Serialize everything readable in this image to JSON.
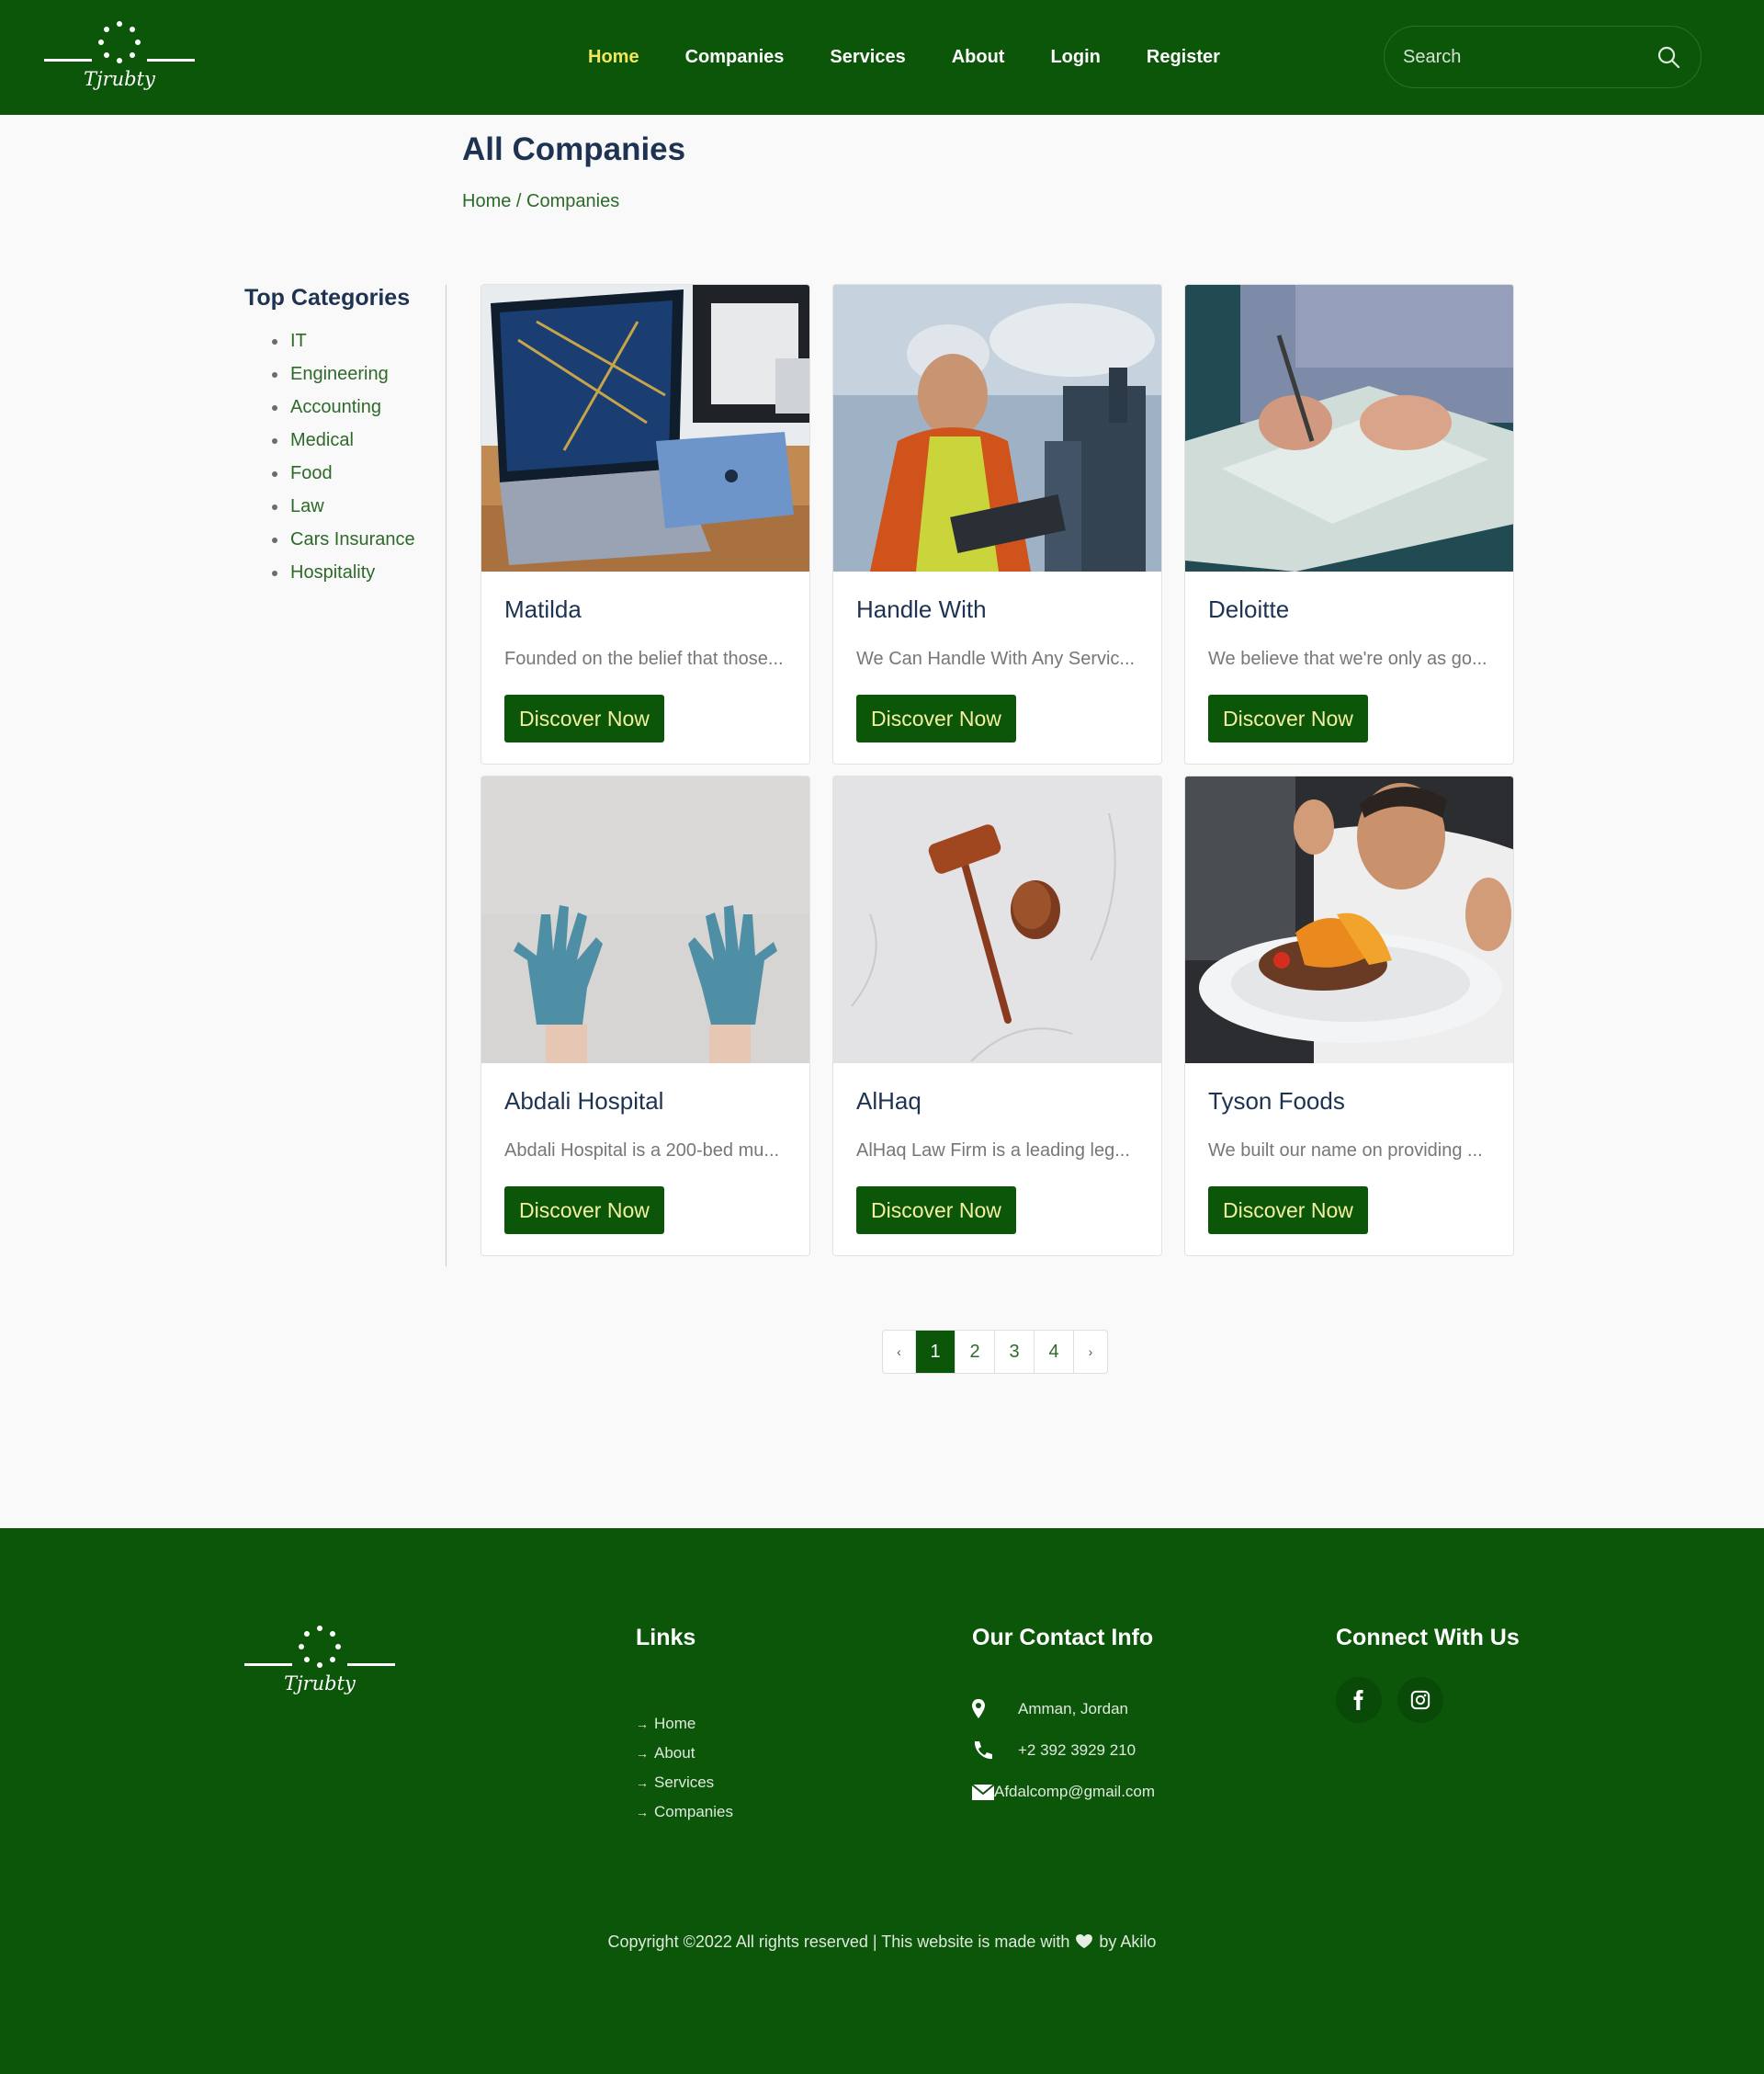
{
  "brand": {
    "name": "Tjrubty"
  },
  "nav": {
    "items": [
      {
        "label": "Home",
        "active": true
      },
      {
        "label": "Companies"
      },
      {
        "label": "Services"
      },
      {
        "label": "About"
      },
      {
        "label": "Login"
      },
      {
        "label": "Register"
      }
    ],
    "search_placeholder": "Search"
  },
  "page": {
    "title": "All Companies",
    "breadcrumb": {
      "home": "Home",
      "separator": " / ",
      "current": "Companies"
    }
  },
  "sidebar": {
    "title": "Top Categories",
    "items": [
      "IT",
      "Engineering",
      "Accounting",
      "Medical",
      "Food",
      "Law",
      "Cars Insurance",
      "Hospitality"
    ]
  },
  "companies": [
    {
      "name": "Matilda",
      "desc": "Founded on the belief that those...",
      "button": "Discover Now",
      "image": "laptop-photo"
    },
    {
      "name": "Handle With",
      "desc": "We Can Handle With Any Servic...",
      "button": "Discover Now",
      "image": "engineer-photo"
    },
    {
      "name": "Deloitte",
      "desc": "We believe that we're only as go...",
      "button": "Discover Now",
      "image": "signing-photo"
    },
    {
      "name": "Abdali Hospital",
      "desc": "Abdali Hospital is a 200-bed mu...",
      "button": "Discover Now",
      "image": "gloves-photo"
    },
    {
      "name": "AlHaq",
      "desc": "AlHaq Law Firm is a leading leg...",
      "button": "Discover Now",
      "image": "gavel-photo"
    },
    {
      "name": "Tyson Foods",
      "desc": "We built our name on providing ...",
      "button": "Discover Now",
      "image": "chef-photo"
    }
  ],
  "pagination": {
    "prev": "‹",
    "pages": [
      "1",
      "2",
      "3",
      "4"
    ],
    "current": "1",
    "next": "›"
  },
  "footer": {
    "links_title": "Links",
    "links": [
      "Home",
      "About",
      "Services",
      "Companies"
    ],
    "contact_title": "Our Contact Info",
    "contact": {
      "address": "Amman, Jordan",
      "phone": "+2 392 3929 210",
      "email": "Afdalcomp@gmail.com"
    },
    "social_title": "Connect With Us",
    "social": [
      "facebook-icon",
      "instagram-icon"
    ],
    "copyright_before": "Copyright ©2022 All rights reserved | This website is made with",
    "copyright_after": "by Akilo"
  },
  "colors": {
    "primary": "#0c560a",
    "active_nav": "#f2e65b",
    "heading": "#1e3352",
    "link": "#2d6a2a"
  }
}
